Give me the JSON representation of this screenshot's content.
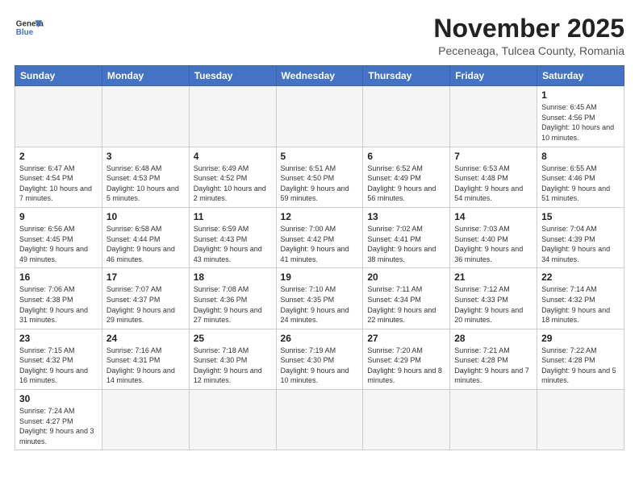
{
  "header": {
    "logo_general": "General",
    "logo_blue": "Blue",
    "title": "November 2025",
    "subtitle": "Peceneaga, Tulcea County, Romania"
  },
  "weekdays": [
    "Sunday",
    "Monday",
    "Tuesday",
    "Wednesday",
    "Thursday",
    "Friday",
    "Saturday"
  ],
  "weeks": [
    [
      {
        "day": "",
        "info": ""
      },
      {
        "day": "",
        "info": ""
      },
      {
        "day": "",
        "info": ""
      },
      {
        "day": "",
        "info": ""
      },
      {
        "day": "",
        "info": ""
      },
      {
        "day": "",
        "info": ""
      },
      {
        "day": "1",
        "info": "Sunrise: 6:45 AM\nSunset: 4:56 PM\nDaylight: 10 hours and 10 minutes."
      }
    ],
    [
      {
        "day": "2",
        "info": "Sunrise: 6:47 AM\nSunset: 4:54 PM\nDaylight: 10 hours and 7 minutes."
      },
      {
        "day": "3",
        "info": "Sunrise: 6:48 AM\nSunset: 4:53 PM\nDaylight: 10 hours and 5 minutes."
      },
      {
        "day": "4",
        "info": "Sunrise: 6:49 AM\nSunset: 4:52 PM\nDaylight: 10 hours and 2 minutes."
      },
      {
        "day": "5",
        "info": "Sunrise: 6:51 AM\nSunset: 4:50 PM\nDaylight: 9 hours and 59 minutes."
      },
      {
        "day": "6",
        "info": "Sunrise: 6:52 AM\nSunset: 4:49 PM\nDaylight: 9 hours and 56 minutes."
      },
      {
        "day": "7",
        "info": "Sunrise: 6:53 AM\nSunset: 4:48 PM\nDaylight: 9 hours and 54 minutes."
      },
      {
        "day": "8",
        "info": "Sunrise: 6:55 AM\nSunset: 4:46 PM\nDaylight: 9 hours and 51 minutes."
      }
    ],
    [
      {
        "day": "9",
        "info": "Sunrise: 6:56 AM\nSunset: 4:45 PM\nDaylight: 9 hours and 49 minutes."
      },
      {
        "day": "10",
        "info": "Sunrise: 6:58 AM\nSunset: 4:44 PM\nDaylight: 9 hours and 46 minutes."
      },
      {
        "day": "11",
        "info": "Sunrise: 6:59 AM\nSunset: 4:43 PM\nDaylight: 9 hours and 43 minutes."
      },
      {
        "day": "12",
        "info": "Sunrise: 7:00 AM\nSunset: 4:42 PM\nDaylight: 9 hours and 41 minutes."
      },
      {
        "day": "13",
        "info": "Sunrise: 7:02 AM\nSunset: 4:41 PM\nDaylight: 9 hours and 38 minutes."
      },
      {
        "day": "14",
        "info": "Sunrise: 7:03 AM\nSunset: 4:40 PM\nDaylight: 9 hours and 36 minutes."
      },
      {
        "day": "15",
        "info": "Sunrise: 7:04 AM\nSunset: 4:39 PM\nDaylight: 9 hours and 34 minutes."
      }
    ],
    [
      {
        "day": "16",
        "info": "Sunrise: 7:06 AM\nSunset: 4:38 PM\nDaylight: 9 hours and 31 minutes."
      },
      {
        "day": "17",
        "info": "Sunrise: 7:07 AM\nSunset: 4:37 PM\nDaylight: 9 hours and 29 minutes."
      },
      {
        "day": "18",
        "info": "Sunrise: 7:08 AM\nSunset: 4:36 PM\nDaylight: 9 hours and 27 minutes."
      },
      {
        "day": "19",
        "info": "Sunrise: 7:10 AM\nSunset: 4:35 PM\nDaylight: 9 hours and 24 minutes."
      },
      {
        "day": "20",
        "info": "Sunrise: 7:11 AM\nSunset: 4:34 PM\nDaylight: 9 hours and 22 minutes."
      },
      {
        "day": "21",
        "info": "Sunrise: 7:12 AM\nSunset: 4:33 PM\nDaylight: 9 hours and 20 minutes."
      },
      {
        "day": "22",
        "info": "Sunrise: 7:14 AM\nSunset: 4:32 PM\nDaylight: 9 hours and 18 minutes."
      }
    ],
    [
      {
        "day": "23",
        "info": "Sunrise: 7:15 AM\nSunset: 4:32 PM\nDaylight: 9 hours and 16 minutes."
      },
      {
        "day": "24",
        "info": "Sunrise: 7:16 AM\nSunset: 4:31 PM\nDaylight: 9 hours and 14 minutes."
      },
      {
        "day": "25",
        "info": "Sunrise: 7:18 AM\nSunset: 4:30 PM\nDaylight: 9 hours and 12 minutes."
      },
      {
        "day": "26",
        "info": "Sunrise: 7:19 AM\nSunset: 4:30 PM\nDaylight: 9 hours and 10 minutes."
      },
      {
        "day": "27",
        "info": "Sunrise: 7:20 AM\nSunset: 4:29 PM\nDaylight: 9 hours and 8 minutes."
      },
      {
        "day": "28",
        "info": "Sunrise: 7:21 AM\nSunset: 4:28 PM\nDaylight: 9 hours and 7 minutes."
      },
      {
        "day": "29",
        "info": "Sunrise: 7:22 AM\nSunset: 4:28 PM\nDaylight: 9 hours and 5 minutes."
      }
    ],
    [
      {
        "day": "30",
        "info": "Sunrise: 7:24 AM\nSunset: 4:27 PM\nDaylight: 9 hours and 3 minutes."
      },
      {
        "day": "",
        "info": ""
      },
      {
        "day": "",
        "info": ""
      },
      {
        "day": "",
        "info": ""
      },
      {
        "day": "",
        "info": ""
      },
      {
        "day": "",
        "info": ""
      },
      {
        "day": "",
        "info": ""
      }
    ]
  ]
}
